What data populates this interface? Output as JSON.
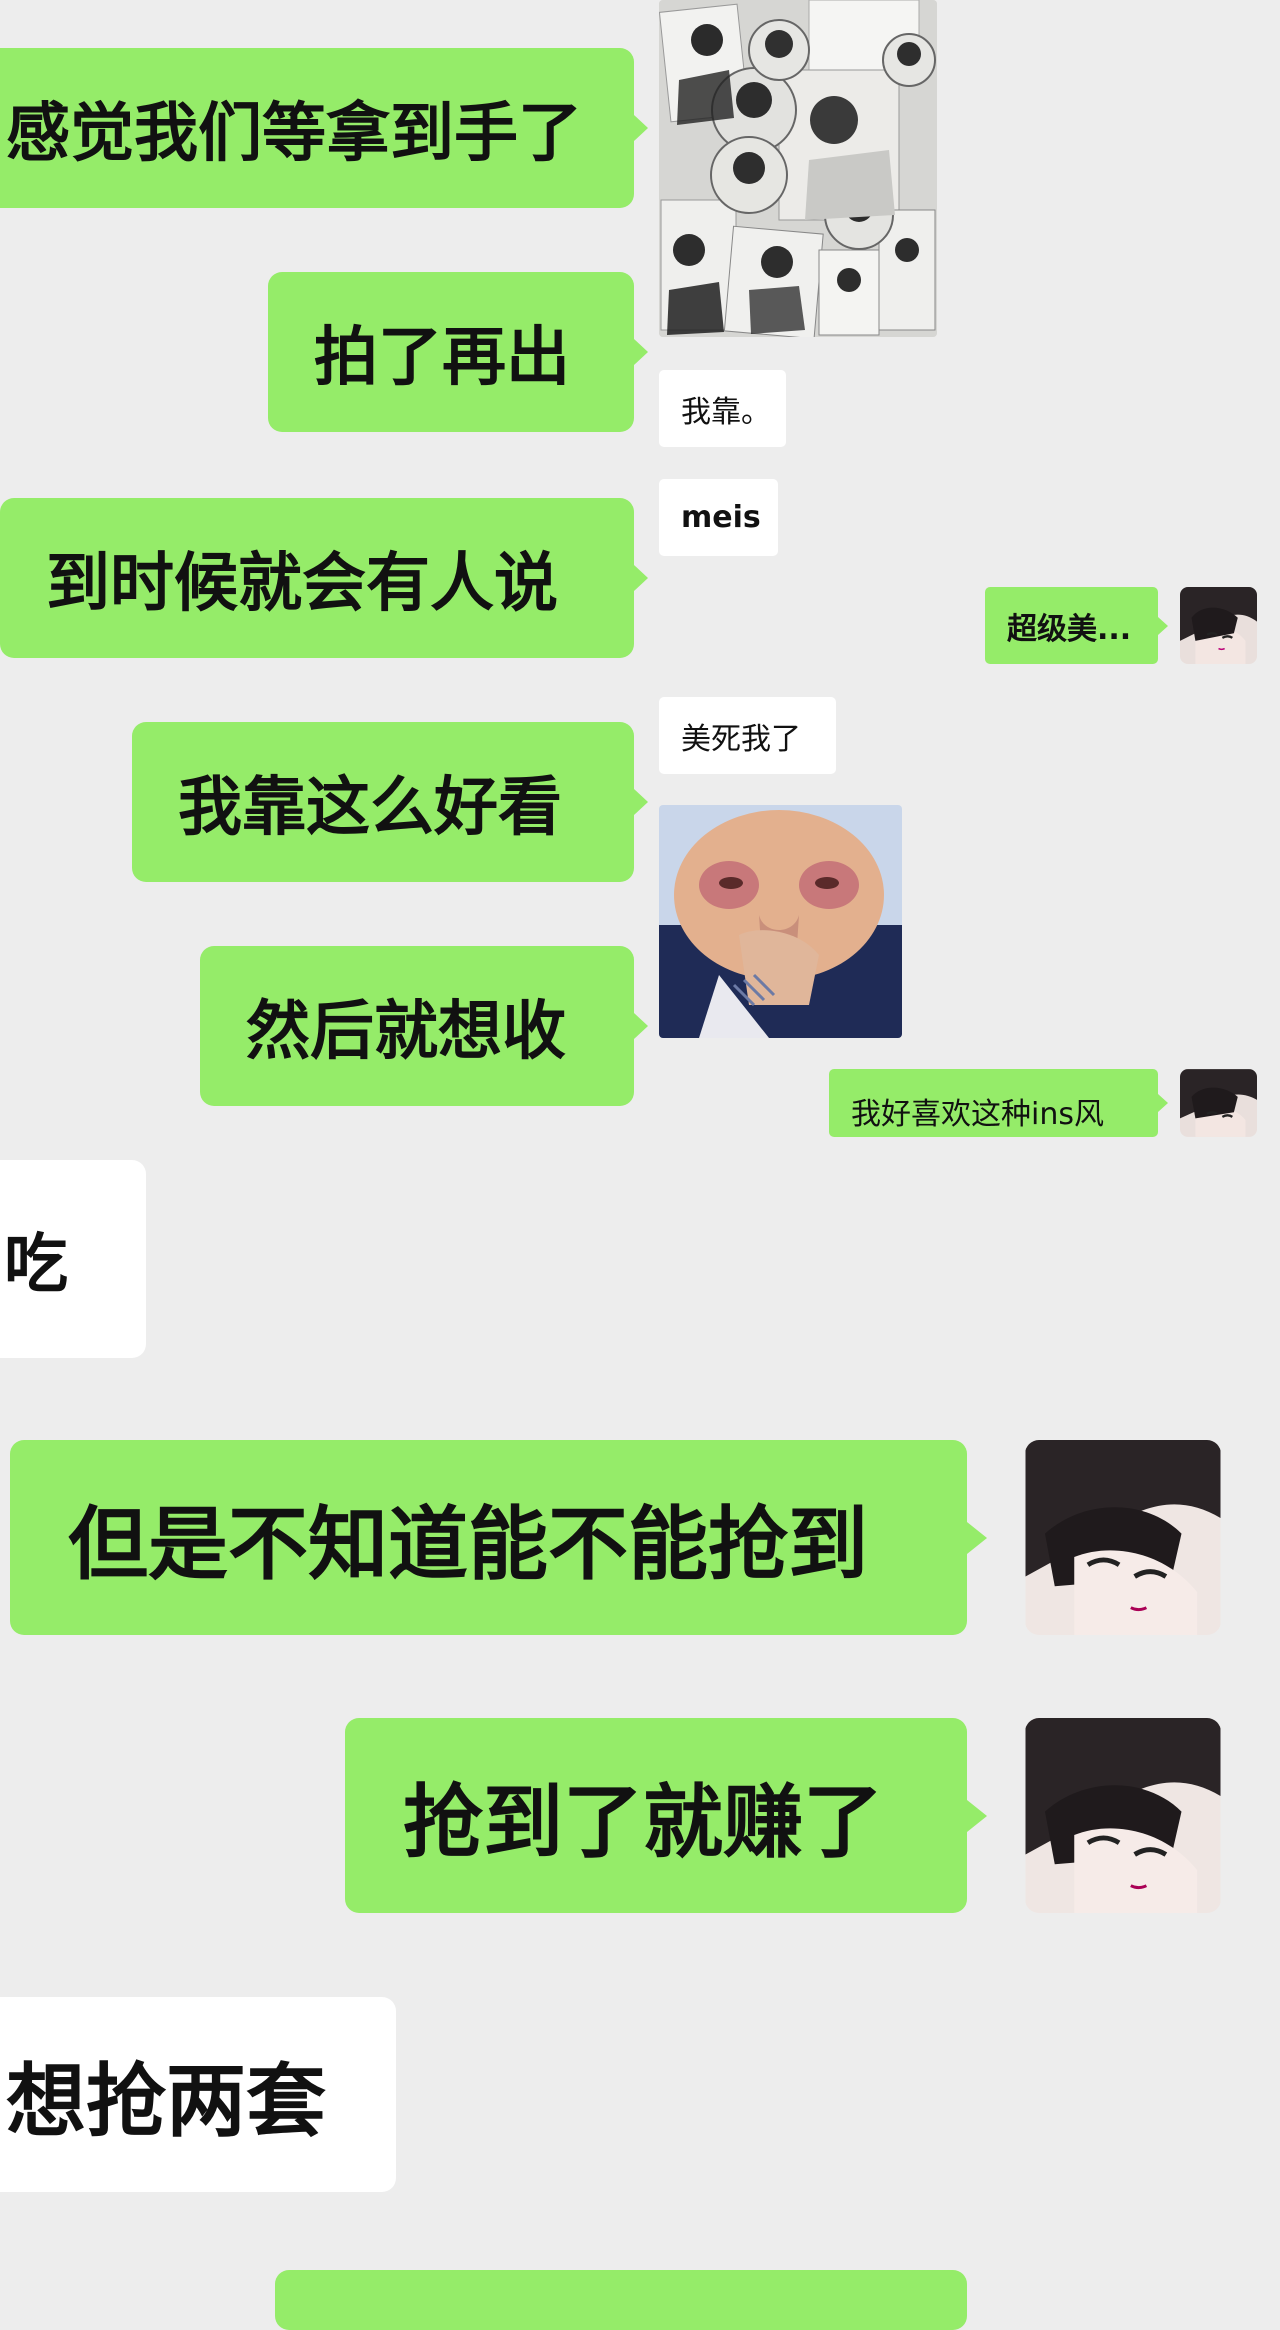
{
  "colors": {
    "background": "#ededed",
    "sent_bubble": "#95ec69",
    "received_bubble": "#ffffff"
  },
  "left_panel": {
    "messages": [
      {
        "text": "感觉我们等拿到手了"
      },
      {
        "text": "拍了再出"
      },
      {
        "text": "到时候就会有人说"
      },
      {
        "text": "我靠这么好看"
      },
      {
        "text": "然后就想收"
      }
    ],
    "received_text": "吃"
  },
  "right_panel": {
    "received": [
      {
        "text": "我靠。"
      },
      {
        "text": "meis"
      },
      {
        "text": "美死我了"
      }
    ],
    "sent": [
      {
        "text": "超级美..."
      },
      {
        "text": "我好喜欢这种ins风"
      }
    ],
    "images": [
      "photocard-collage-image",
      "crying-face-sticker"
    ]
  },
  "bottom": {
    "sent": [
      {
        "text": "但是不知道能不能抢到"
      },
      {
        "text": "抢到了就赚了"
      }
    ],
    "received": [
      {
        "text": "想抢两套"
      }
    ]
  }
}
